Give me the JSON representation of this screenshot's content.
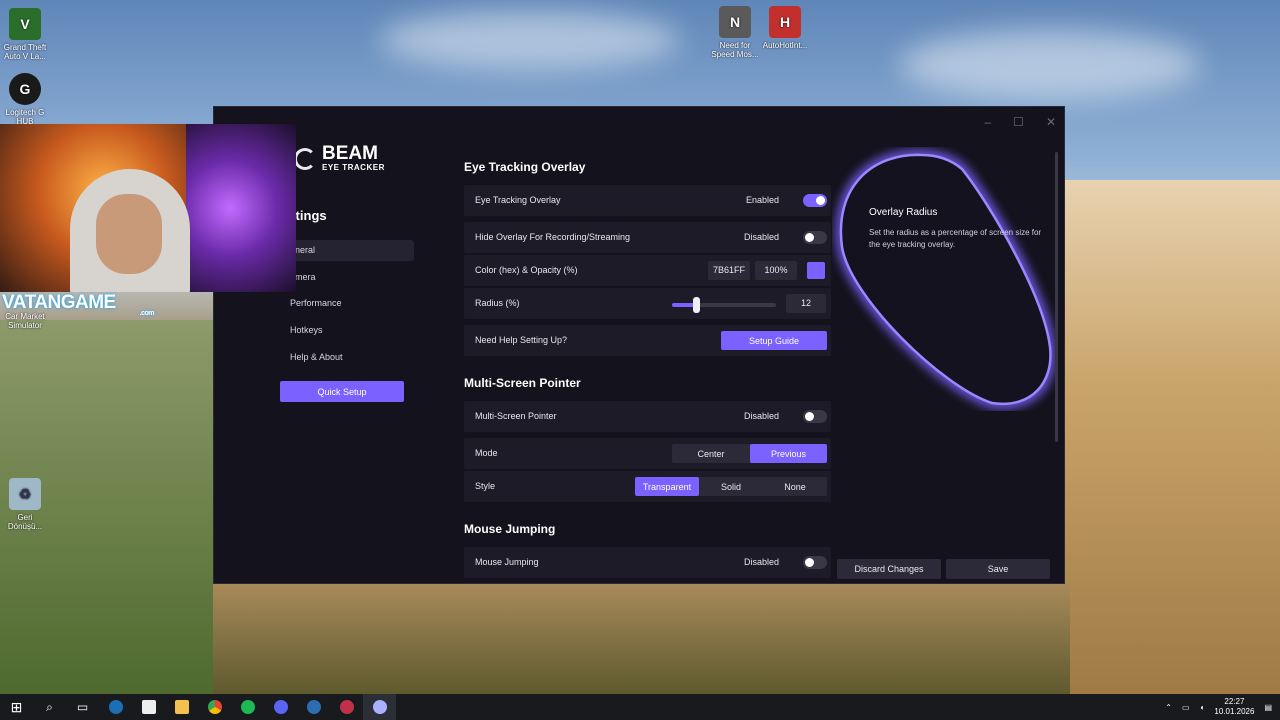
{
  "desktop": {
    "icons": [
      {
        "name": "gta-icon",
        "label": "Grand Theft Auto V La...",
        "glyph": "V",
        "color": "#2b6e2b"
      },
      {
        "name": "logitech-icon",
        "label": "Logitech G HUB",
        "glyph": "G",
        "color": "#1a1a1a"
      },
      {
        "name": "market-icon",
        "label": "Car Market Simulator",
        "glyph": "",
        "color": "#4d6b2a"
      },
      {
        "name": "recycle-bin-icon",
        "label": "Geri Dönüşü...",
        "glyph": "♻",
        "color": "#9fb8c8"
      },
      {
        "name": "nfs-icon",
        "label": "Need for Speed Mos...",
        "glyph": "N",
        "color": "#5a5a5a"
      },
      {
        "name": "autohotkey-icon",
        "label": "AutoHotInt...",
        "glyph": "H",
        "color": "#c2302e"
      }
    ],
    "stream_logo": "VATANGAME",
    "stream_logo_sub": ".com"
  },
  "window": {
    "controls": {
      "minimize": "–",
      "maximize": "☐",
      "close": "✕"
    },
    "brand": {
      "name": "BEAM",
      "sub": "EYE TRACKER"
    },
    "sidebar": {
      "title": "ettings",
      "items": [
        {
          "label": "eneral",
          "active": true
        },
        {
          "label": "amera",
          "active": false
        },
        {
          "label": "Performance",
          "active": false
        },
        {
          "label": "Hotkeys",
          "active": false
        },
        {
          "label": "Help & About",
          "active": false
        }
      ],
      "quick_setup": "Quick Setup"
    },
    "sections": {
      "eye_tracking": {
        "title": "Eye Tracking Overlay",
        "overlay": {
          "label": "Eye Tracking Overlay",
          "state": "Enabled",
          "on": true
        },
        "hide_overlay": {
          "label": "Hide Overlay For Recording/Streaming",
          "state": "Disabled",
          "on": false
        },
        "color": {
          "label": "Color (hex) & Opacity (%)",
          "hex": "7B61FF",
          "opacity": "100%",
          "swatch": "#7b61ff"
        },
        "radius": {
          "label": "Radius (%)",
          "value": "12",
          "fraction": 0.24
        },
        "help": {
          "label": "Need Help Setting Up?",
          "button": "Setup Guide"
        }
      },
      "multi_screen": {
        "title": "Multi-Screen Pointer",
        "pointer": {
          "label": "Multi-Screen Pointer",
          "state": "Disabled",
          "on": false
        },
        "mode": {
          "label": "Mode",
          "options": [
            "Center",
            "Previous"
          ],
          "selected": "Previous"
        },
        "style": {
          "label": "Style",
          "options": [
            "Transparent",
            "Solid",
            "None"
          ],
          "selected": "Transparent"
        }
      },
      "mouse_jumping": {
        "title": "Mouse Jumping",
        "jumping": {
          "label": "Mouse Jumping",
          "state": "Disabled",
          "on": false
        }
      }
    },
    "info": {
      "title": "Overlay Radius",
      "text": "Set the radius as a percentage of screen size for the eye tracking overlay."
    },
    "footer": {
      "discard": "Discard Changes",
      "save": "Save"
    },
    "accent": "#7b61ff"
  },
  "taskbar": {
    "icons": [
      "windows-icon",
      "search-icon",
      "task-view-icon",
      "steam-icon",
      "store-icon",
      "folder-icon",
      "chrome-icon",
      "spotify-icon",
      "discord-icon",
      "steam-icon-2",
      "app-icon",
      "beam-icon"
    ],
    "time": "22:27",
    "date": "10.01.2026"
  }
}
